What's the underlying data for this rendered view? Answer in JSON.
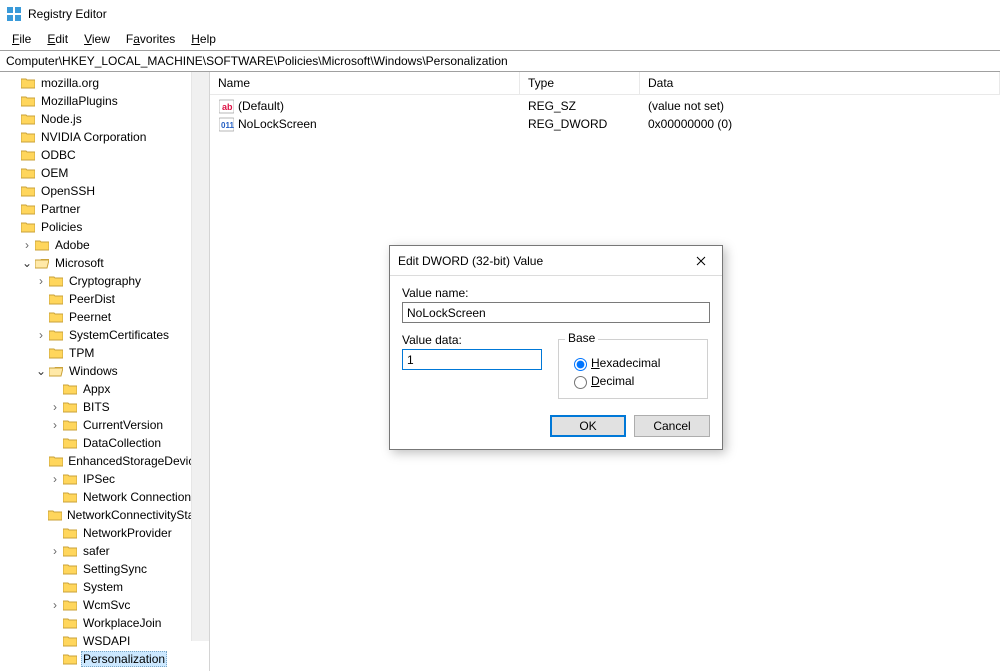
{
  "window": {
    "title": "Registry Editor"
  },
  "menu": {
    "file": "File",
    "edit": "Edit",
    "view": "View",
    "favorites": "Favorites",
    "help": "Help"
  },
  "address": "Computer\\HKEY_LOCAL_MACHINE\\SOFTWARE\\Policies\\Microsoft\\Windows\\Personalization",
  "tree": {
    "t0": "mozilla.org",
    "t1": "MozillaPlugins",
    "t2": "Node.js",
    "t3": "NVIDIA Corporation",
    "t4": "ODBC",
    "t5": "OEM",
    "t6": "OpenSSH",
    "t7": "Partner",
    "t8": "Policies",
    "t9": "Adobe",
    "t10": "Microsoft",
    "t11": "Cryptography",
    "t12": "PeerDist",
    "t13": "Peernet",
    "t14": "SystemCertificates",
    "t15": "TPM",
    "t16": "Windows",
    "t17": "Appx",
    "t18": "BITS",
    "t19": "CurrentVersion",
    "t20": "DataCollection",
    "t21": "EnhancedStorageDevices",
    "t22": "IPSec",
    "t23": "Network Connections",
    "t24": "NetworkConnectivityStatus",
    "t25": "NetworkProvider",
    "t26": "safer",
    "t27": "SettingSync",
    "t28": "System",
    "t29": "WcmSvc",
    "t30": "WorkplaceJoin",
    "t31": "WSDAPI",
    "t32": "Personalization"
  },
  "list": {
    "hdr": {
      "name": "Name",
      "type": "Type",
      "data": "Data"
    },
    "rows": [
      {
        "name": "(Default)",
        "type": "REG_SZ",
        "data": "(value not set)",
        "icon": "string"
      },
      {
        "name": "NoLockScreen",
        "type": "REG_DWORD",
        "data": "0x00000000 (0)",
        "icon": "binary"
      }
    ]
  },
  "dialog": {
    "title": "Edit DWORD (32-bit) Value",
    "valuename_label": "Value name:",
    "valuename": "NoLockScreen",
    "valuedata_label": "Value data:",
    "valuedata": "1",
    "base_label": "Base",
    "hex": "Hexadecimal",
    "dec": "Decimal",
    "ok": "OK",
    "cancel": "Cancel"
  }
}
